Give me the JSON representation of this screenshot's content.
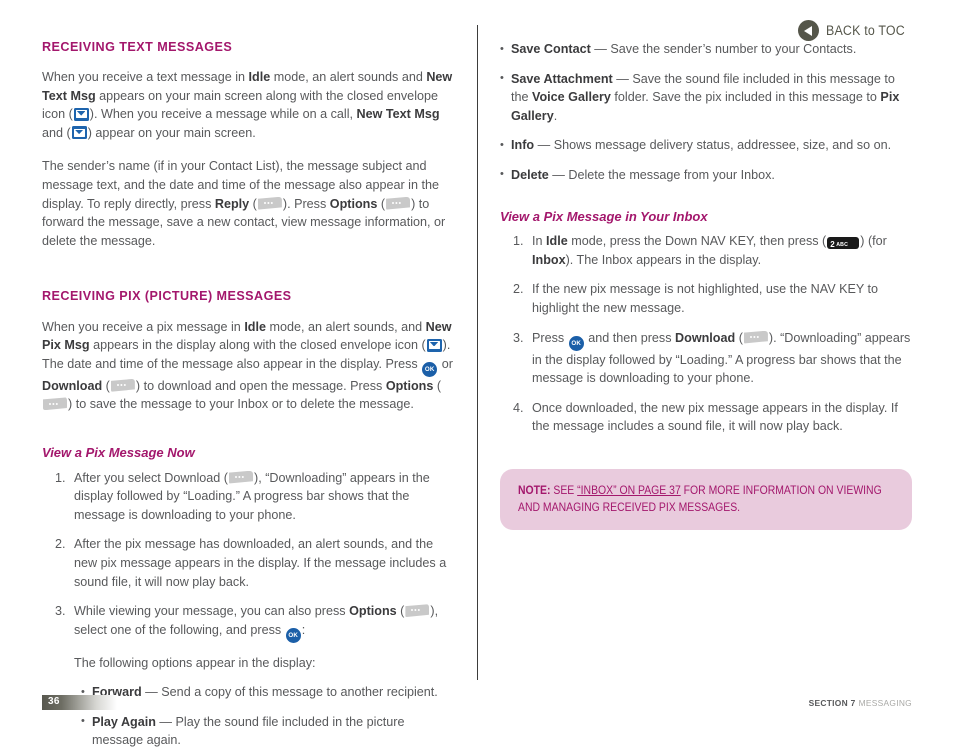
{
  "header": {
    "back_to_toc": "BACK to TOC"
  },
  "colors": {
    "heading_magenta": "#a3176c",
    "body_gray": "#58595b",
    "note_background": "#e9cbdd",
    "envelope_blue": "#1e64ad",
    "ok_key_blue": "#1b5fa8",
    "softkey_gray": "#c9c9c9",
    "toc_olive": "#55564a"
  },
  "left_column": {
    "section1": {
      "heading": "RECEIVING TEXT MESSAGES",
      "para1_a": "When you receive a text message in ",
      "para1_b": "Idle",
      "para1_c": " mode, an alert sounds and ",
      "para1_d": "New Text Msg",
      "para1_e": " appears on your main screen along with the closed envelope icon (",
      "para1_f": "). When you receive a message while on a call, ",
      "para1_g": "New Text Msg",
      "para1_h": " and (",
      "para1_i": ") appear on your main screen.",
      "para2_a": "The sender’s name (if in your Contact List), the message subject and message text, and the date and time of the message also appear in the display. To reply directly, press ",
      "para2_b": "Reply",
      "para2_c": " (",
      "para2_d": "). Press ",
      "para2_e": "Options",
      "para2_f": " (",
      "para2_g": ") to forward the message, save a new contact, view message information, or delete the message."
    },
    "section2": {
      "heading": "RECEIVING PIX (PICTURE) MESSAGES",
      "para1_a": "When you receive a pix message in ",
      "para1_b": "Idle",
      "para1_c": " mode, an alert sounds, and ",
      "para1_d": "New Pix Msg",
      "para1_e": " appears in the display along with the closed envelope icon (",
      "para1_f": "). The date and time of the message also appear in the display. Press ",
      "para1_g": " or ",
      "para1_h": "Download",
      "para1_i": " (",
      "para1_j": ") to download and open the message. Press ",
      "para1_k": "Options",
      "para1_l": " (",
      "para1_m": ") to save the message to your Inbox or to delete the message."
    },
    "subsection": {
      "heading": "View a Pix Message Now",
      "steps": [
        {
          "part_a": "After you select Download (",
          "part_b": "), “Downloading” appears in the display followed by “Loading.” A progress bar shows that the message is downloading to your phone."
        },
        {
          "part_a": "After the pix message has downloaded, an alert sounds, and the new pix message appears in the display. If the message includes a sound file, it will now play back."
        },
        {
          "part_a": "While viewing your message, you can also press ",
          "part_b": "Options",
          "part_c": " (",
          "part_d": "), select one of the following, and press ",
          "part_e": ":",
          "sub_para": "The following options appear in the display:",
          "bullets": [
            {
              "term": "Forward",
              "dash": " — ",
              "desc": "Send a copy of this message to another recipient."
            },
            {
              "term": "Play Again",
              "dash": " — ",
              "desc": "Play the sound file included in the picture message again."
            }
          ]
        }
      ]
    }
  },
  "right_column": {
    "bullets": [
      {
        "term": "Save Contact",
        "dash": " — ",
        "desc": "Save the sender’s number to your Contacts."
      },
      {
        "term": "Save Attachment",
        "dash": " — ",
        "desc_a": "Save the sound file included in this message to the ",
        "desc_b": "Voice Gallery",
        "desc_c": " folder. Save the pix included in this message to ",
        "desc_d": "Pix Gallery",
        "desc_e": "."
      },
      {
        "term": "Info",
        "dash": " — ",
        "desc": "Shows message delivery status, addressee, size, and so on."
      },
      {
        "term": "Delete",
        "dash": " — ",
        "desc": "Delete the message from your Inbox."
      }
    ],
    "subsection": {
      "heading": "View a Pix Message in Your Inbox",
      "steps": [
        {
          "part_a": "In ",
          "part_b": "Idle",
          "part_c": " mode, press the Down NAV KEY, then press (",
          "part_d": ") (for ",
          "part_e": "Inbox",
          "part_f": "). The Inbox appears in the display."
        },
        {
          "part_a": "If the new pix message is not highlighted, use the NAV KEY to highlight the new message."
        },
        {
          "part_a": "Press ",
          "part_b": " and then press ",
          "part_c": "Download",
          "part_d": " (",
          "part_e": "). “Downloading” appears in the display followed by “Loading.” A progress bar shows that the message is downloading to your phone."
        },
        {
          "part_a": "Once downloaded, the new pix message appears in the display. If the message includes a sound file, it will now play back."
        }
      ]
    },
    "note": {
      "lead": "NOTE:",
      "text_a": " SEE ",
      "link": "“INBOX” ON PAGE 37",
      "text_b": " FOR MORE INFORMATION ON VIEWING AND MANAGING RECEIVED PIX MESSAGES."
    }
  },
  "icons": {
    "envelope": "closed-envelope-icon",
    "ok_key": "ok-key-icon",
    "soft_key": "soft-key-icon",
    "key_2": {
      "number": "2",
      "letters": "ABC"
    },
    "back_arrow": "back-arrow-icon"
  },
  "footer": {
    "page_number": "36",
    "section_label": "SECTION 7",
    "section_name": "MESSAGING"
  }
}
